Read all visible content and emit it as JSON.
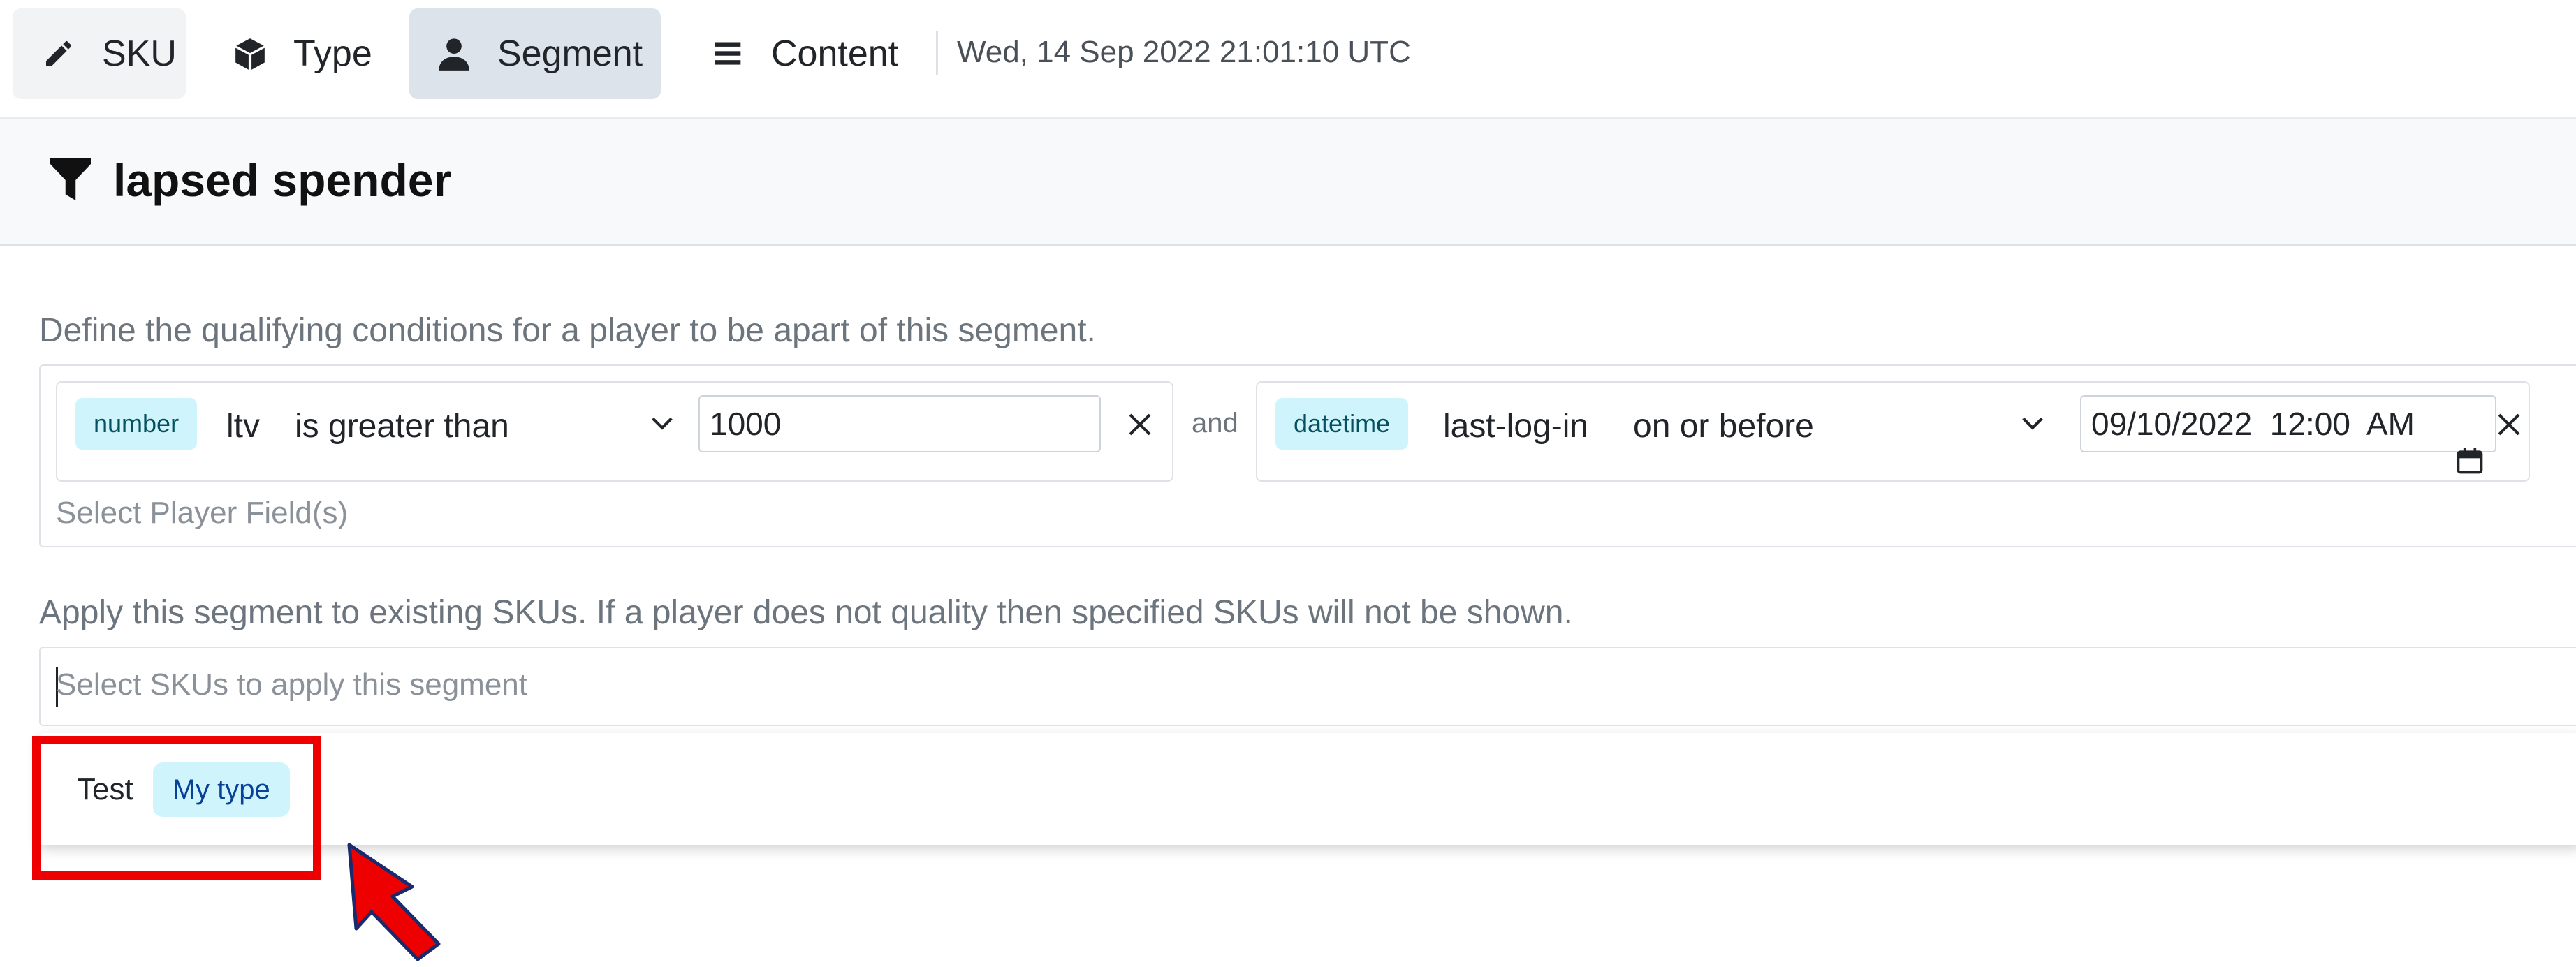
{
  "nav": {
    "tabs": [
      {
        "label": "SKU",
        "icon": "pencil-icon"
      },
      {
        "label": "Type",
        "icon": "cube-icon"
      },
      {
        "label": "Segment",
        "icon": "user-icon",
        "active": true
      },
      {
        "label": "Content",
        "icon": "list-icon"
      }
    ],
    "timestamp": "Wed, 14 Sep 2022 21:01:10 UTC"
  },
  "segment": {
    "title": "lapsed spender",
    "icon": "filter-icon"
  },
  "conditions": {
    "description": "Define the qualifying conditions for a player to be apart of this segment.",
    "items": [
      {
        "type_badge": "number",
        "field": "ltv",
        "operator": "is greater than",
        "value": "1000"
      },
      {
        "type_badge": "datetime",
        "field": "last-log-in",
        "operator": "on or before",
        "value": "09/10/2022  12:00  AM"
      }
    ],
    "joiner": "and",
    "placeholder": "Select Player Field(s)"
  },
  "apply": {
    "description": "Apply this segment to existing SKUs. If a player does not quality then specified SKUs will not be shown.",
    "placeholder": "Select SKUs to apply this segment",
    "options": [
      {
        "label": "Test",
        "badge": "My type"
      }
    ]
  },
  "colors": {
    "active_tab_bg": "#dde3ea",
    "badge_bg": "#cff4fc",
    "highlight": "#ee0000"
  }
}
